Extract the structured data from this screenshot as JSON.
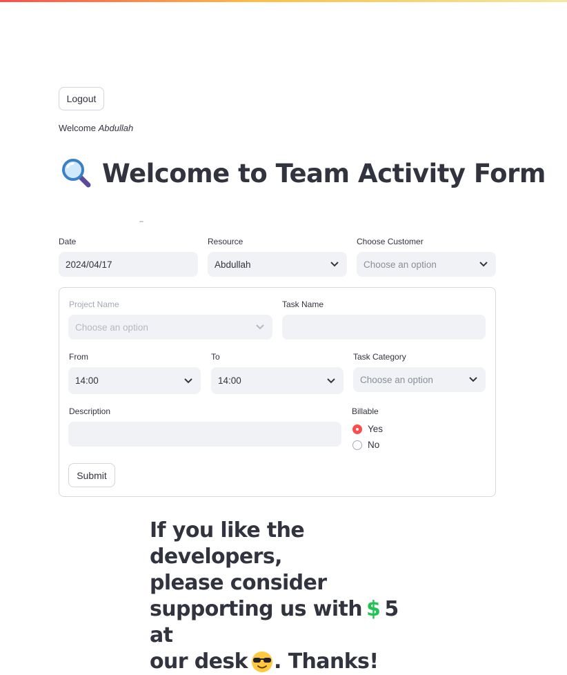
{
  "header": {
    "logout_label": "Logout"
  },
  "welcome": {
    "prefix": "Welcome",
    "user": "Abdullah"
  },
  "page": {
    "title": "Welcome to Team Activity Form",
    "title_icon": "magnifying-glass-icon"
  },
  "top_fields": {
    "date": {
      "label": "Date",
      "value": "2024/04/17"
    },
    "resource": {
      "label": "Resource",
      "value": "Abdullah"
    },
    "customer": {
      "label": "Choose Customer",
      "placeholder": "Choose an option"
    }
  },
  "form": {
    "project": {
      "label": "Project Name",
      "placeholder": "Choose an option",
      "disabled": true
    },
    "task_name": {
      "label": "Task Name",
      "value": ""
    },
    "from": {
      "label": "From",
      "value": "14:00"
    },
    "to": {
      "label": "To",
      "value": "14:00"
    },
    "task_category": {
      "label": "Task Category",
      "placeholder": "Choose an option"
    },
    "description": {
      "label": "Description",
      "value": ""
    },
    "billable": {
      "label": "Billable",
      "options": [
        "Yes",
        "No"
      ],
      "selected": "Yes"
    },
    "submit_label": "Submit"
  },
  "footer": {
    "line1": "If you like the developers,",
    "line2": "please consider",
    "line3_a": "supporting us with",
    "line3_b": "5 at",
    "line4_a": "our desk",
    "line4_b": ". Thanks!",
    "money_icon": "dollar-icon",
    "emoji_icon": "sunglasses-face-icon"
  },
  "colors": {
    "accent": "#ff4b4b",
    "field_bg": "#f0f2f6",
    "text": "#31333f",
    "dollar": "#21c354"
  }
}
